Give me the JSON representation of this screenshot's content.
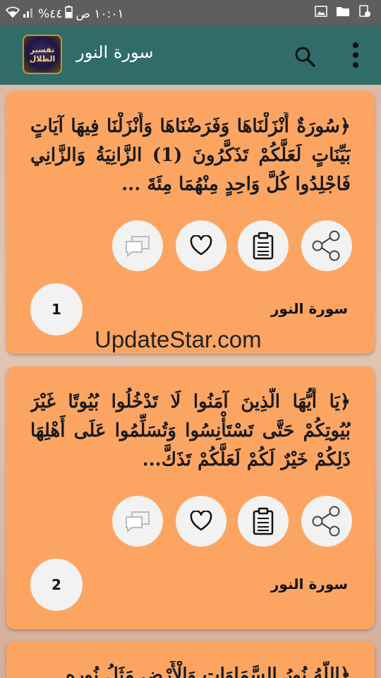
{
  "status_bar": {
    "time": "١٠:٠١ ص",
    "battery": "٤٤%"
  },
  "app_bar": {
    "logo_line1": "تفسير",
    "logo_line2": "الظلال",
    "title": "سورة النور"
  },
  "cards": [
    {
      "text": "﴿سُورَةٌ أَنْزَلْنَاهَا وَفَرَضْنَاهَا وَأَنْزَلْنَا فِيهَا آيَاتٍ بَيِّنَاتٍ لَعَلَّكُمْ تَذَكَّرُونَ (1) الزَّانِيَةُ وَالزَّانِي فَاجْلِدُوا كُلَّ وَاحِدٍ مِنْهُمَا مِئَةَ ...",
      "surah": "سورة النور",
      "number": "1"
    },
    {
      "text": "﴿يَا أَيُّهَا الَّذِينَ آمَنُوا لَا تَدْخُلُوا بُيُوتًا غَيْرَ بُيُوتِكُمْ حَتَّى تَسْتَأْنِسُوا وَتُسَلِّمُوا عَلَى أَهْلِهَا ذَلِكُمْ خَيْرٌ لَكُمْ لَعَلَّكُمْ تَذَكَّ...",
      "surah": "سورة النور",
      "number": "2"
    },
    {
      "text": "﴿اللَّهُ نُورُ السَّمَاوَاتِ وَالْأَرْضِ مَثَلُ نُورِهِ"
    }
  ],
  "watermark": "UpdateStar.com",
  "colors": {
    "app_bar": "#2f6c6a",
    "card": "#fca562",
    "status_bar": "#5e5e5e"
  }
}
